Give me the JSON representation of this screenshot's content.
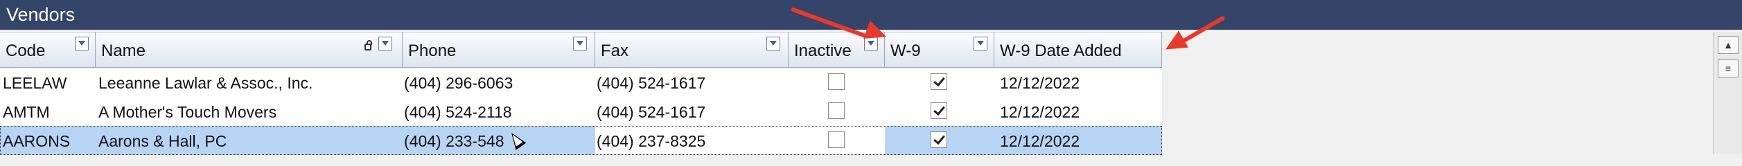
{
  "window": {
    "title": "Vendors"
  },
  "columns": [
    {
      "key": "code",
      "label": "Code"
    },
    {
      "key": "name",
      "label": "Name"
    },
    {
      "key": "phone",
      "label": "Phone"
    },
    {
      "key": "fax",
      "label": "Fax"
    },
    {
      "key": "inactive",
      "label": "Inactive"
    },
    {
      "key": "w9",
      "label": "W-9"
    },
    {
      "key": "w9_date",
      "label": "W-9 Date Added"
    }
  ],
  "rows": [
    {
      "code": "LEELAW",
      "name": " Leeanne Lawlar & Assoc., Inc.",
      "phone": "(404) 296-6063",
      "fax": "(404) 524-1617",
      "inactive": false,
      "w9": true,
      "w9_date": "12/12/2022",
      "selected": false
    },
    {
      "code": "AMTM",
      "name": "A Mother's Touch Movers",
      "phone": "(404) 524-2118",
      "fax": "(404) 524-1617",
      "inactive": false,
      "w9": true,
      "w9_date": "12/12/2022",
      "selected": false
    },
    {
      "code": "AARONS",
      "name": "Aarons & Hall, PC",
      "phone": "(404) 233-548",
      "fax": "(404) 237-8325",
      "inactive": false,
      "w9": true,
      "w9_date": "12/12/2022",
      "selected": true
    }
  ],
  "icons": {
    "filter": "filter-icon",
    "lock": "lock-icon",
    "scroll_up": "scroll-up-icon",
    "scroll_page": "scroll-page-icon",
    "annotation_arrow": "red-arrow-icon"
  },
  "colors": {
    "titlebar": "#344569",
    "selection": "#b8d4f5",
    "annotation": "#e53a2d"
  }
}
